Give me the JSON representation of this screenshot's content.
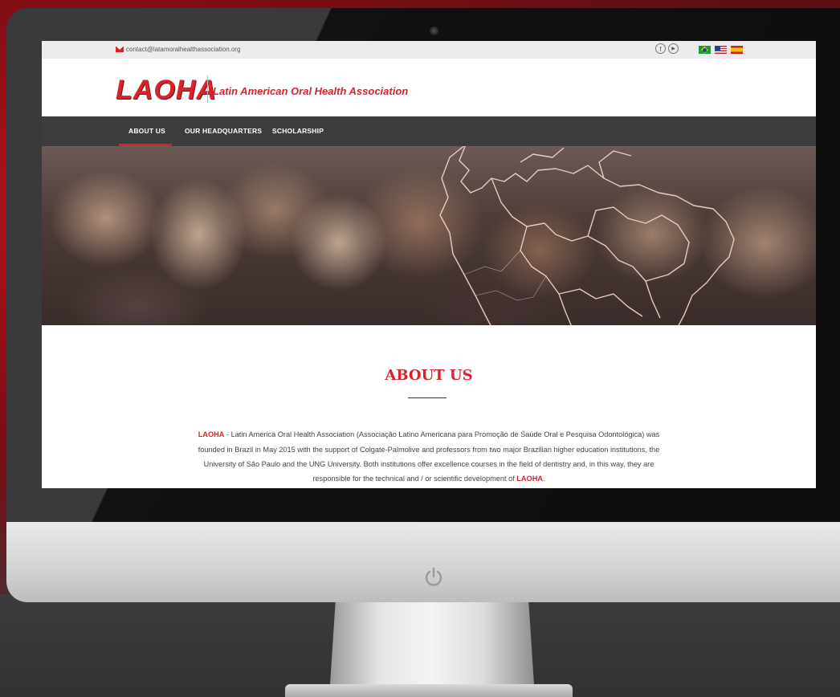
{
  "topbar": {
    "email": "contact@latamoralhealthassociation.org",
    "social": [
      {
        "icon": "facebook-icon",
        "glyph": "f"
      },
      {
        "icon": "youtube-icon",
        "glyph": "▶"
      }
    ],
    "languages": [
      "pt-BR flag",
      "en-US flag",
      "es flag"
    ]
  },
  "header": {
    "logo": "LAOHA",
    "tagline": "Latin American Oral Health Association"
  },
  "nav": {
    "items": [
      {
        "label": "ABOUT US"
      },
      {
        "label": "OUR HEADQUARTERS"
      },
      {
        "label": "SCHOLARSHIP"
      }
    ]
  },
  "about": {
    "title": "ABOUT US",
    "lead": "LAOHA",
    "body": " - Latin America Oral Health Association (Associação Latino Americana para Promoção de Saúde Oral e Pesquisa Odontológica) was founded in Brazil in May 2015 with the support of Colgate-Palmolive and professors from two major Brazilian higher education institutions, the University of São Paulo and the UNG University. Both institutions offer excellence courses in the field of dentistry and, in this way, they are responsible for the technical and / or scientific development of ",
    "tail": "LAOHA",
    "tail_punct": "."
  },
  "colors": {
    "brand_red": "#d9232c",
    "nav_bg": "#3c3c3e"
  }
}
